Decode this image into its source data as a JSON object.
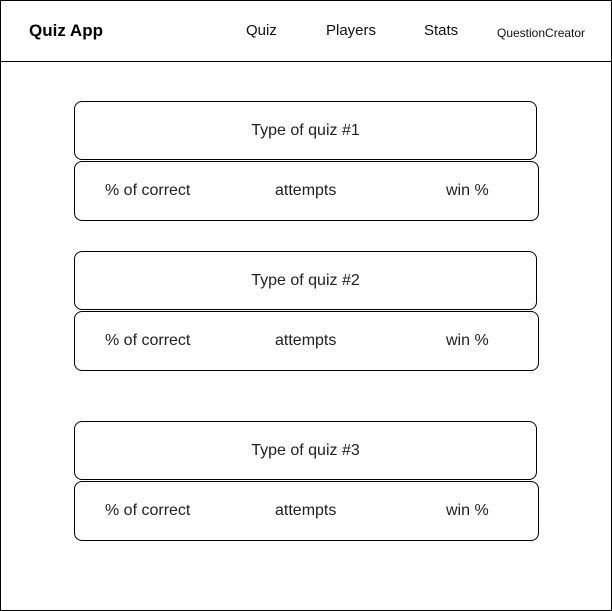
{
  "header": {
    "app_title": "Quiz App",
    "nav": {
      "quiz": "Quiz",
      "players": "Players",
      "stats": "Stats",
      "question_creator": "QuestionCreator"
    }
  },
  "quizzes": [
    {
      "title": "Type of quiz #1",
      "correct_label": "% of correct",
      "attempts_label": "attempts",
      "win_label": "win %"
    },
    {
      "title": "Type of quiz #2",
      "correct_label": "% of correct",
      "attempts_label": "attempts",
      "win_label": "win %"
    },
    {
      "title": "Type of quiz #3",
      "correct_label": "% of correct",
      "attempts_label": "attempts",
      "win_label": "win %"
    }
  ]
}
